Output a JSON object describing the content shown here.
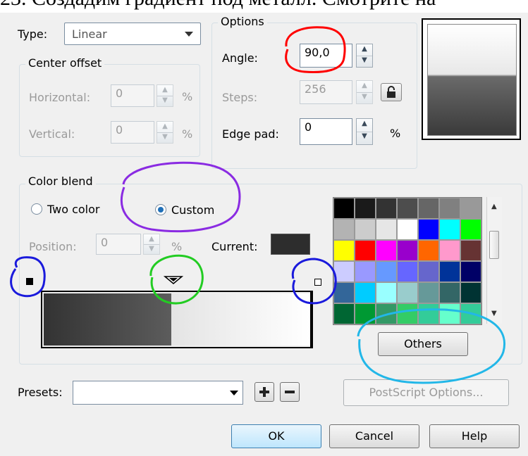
{
  "header_text": "23. Создадим градиент под металл. Смотрите на",
  "type": {
    "label": "Type:",
    "value": "Linear"
  },
  "center_offset": {
    "title": "Center offset",
    "horizontal_label": "Horizontal:",
    "horizontal_value": "0",
    "vertical_label": "Vertical:",
    "vertical_value": "0",
    "unit": "%"
  },
  "options": {
    "title": "Options",
    "angle_label": "Angle:",
    "angle_value": "90,0",
    "steps_label": "Steps:",
    "steps_value": "256",
    "edge_pad_label": "Edge pad:",
    "edge_pad_value": "0",
    "unit": "%"
  },
  "color_blend": {
    "title": "Color blend",
    "two_color_label": "Two color",
    "custom_label": "Custom",
    "selected": "custom",
    "position_label": "Position:",
    "position_value": "0",
    "unit": "%",
    "current_label": "Current:",
    "current_color": "#2d2d2d",
    "others_label": "Others"
  },
  "palette": [
    [
      "#000000",
      "#1a1a1a",
      "#333333",
      "#4d4d4d",
      "#666666",
      "#808080",
      "#999999"
    ],
    [
      "#b3b3b3",
      "#cccccc",
      "#e6e6e6",
      "#ffffff",
      "#0000ff",
      "#00ffff",
      "#00ff00"
    ],
    [
      "#ffff00",
      "#ff0000",
      "#ff00ff",
      "#9900cc",
      "#ff6600",
      "#ff99cc",
      "#663333"
    ],
    [
      "#ccccff",
      "#9999ff",
      "#6699ff",
      "#6666ff",
      "#6666cc",
      "#003399",
      "#000066"
    ],
    [
      "#336699",
      "#00ccff",
      "#99ffff",
      "#99cccc",
      "#669999",
      "#336666",
      "#003333"
    ],
    [
      "#006633",
      "#009933",
      "#339966",
      "#33cc66",
      "#33cc99",
      "#66ffcc",
      "#33cc99"
    ]
  ],
  "presets": {
    "label": "Presets:",
    "value": ""
  },
  "buttons": {
    "postscript": "PostScript Options...",
    "ok": "OK",
    "cancel": "Cancel",
    "help": "Help"
  },
  "gradient": {
    "dark_start": "#333333",
    "dark_end": "#5c5c5c",
    "light_start": "#e4e4e4",
    "light_end": "#ffffff",
    "split_fraction": 0.48
  },
  "annotation_colors": {
    "red": "#ff0000",
    "purple": "#8a2be2",
    "green": "#22cc22",
    "blue": "#1a1adc",
    "cyan": "#22b7e8"
  }
}
